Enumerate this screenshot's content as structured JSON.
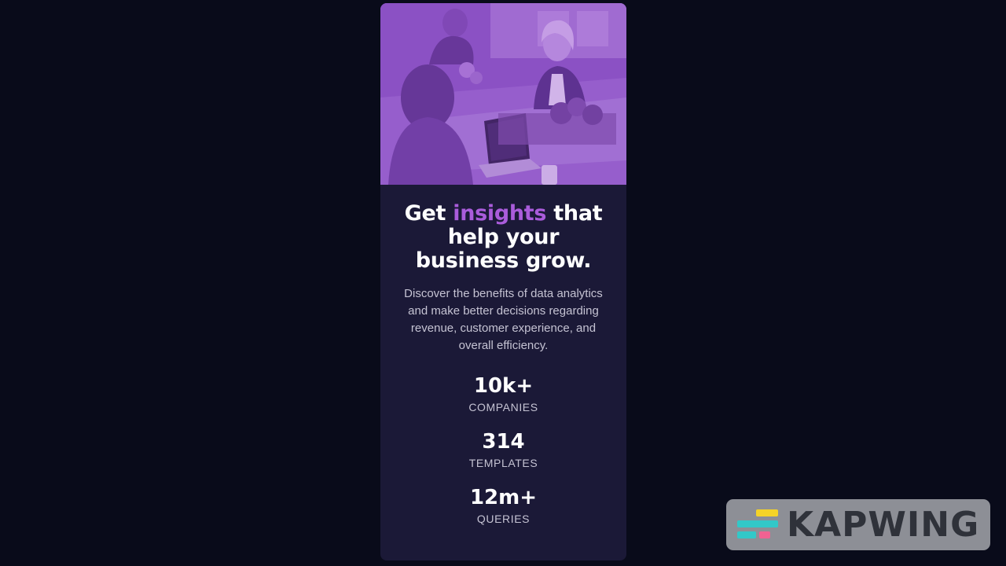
{
  "card": {
    "hero_image_alt": "",
    "title_part1": "Get ",
    "title_accent": "insights",
    "title_part2": " that help your business grow.",
    "description": "Discover the benefits of data analytics and make better decisions regarding revenue, customer experience, and overall efficiency.",
    "stats": [
      {
        "value": "10k+",
        "label": "COMPANIES"
      },
      {
        "value": "314",
        "label": "TEMPLATES"
      },
      {
        "value": "12m+",
        "label": "QUERIES"
      }
    ]
  },
  "watermark": {
    "text": "KAPWING"
  },
  "colors": {
    "page_background": "#090b1a",
    "card_background": "#1b1937",
    "accent": "#aa5cdb",
    "hero_tint": "#8a4fc2"
  }
}
